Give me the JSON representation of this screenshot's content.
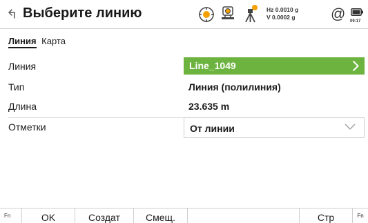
{
  "header": {
    "title": "Выберите линию",
    "hz_line": "Hz 0.0010 g",
    "v_line": "V  0.0002 g",
    "at_symbol": "@",
    "time": "09:17",
    "icons": [
      "back-icon",
      "target-icon",
      "instrument-icon",
      "tripod-icon",
      "battery-icon"
    ]
  },
  "tabs": {
    "active": "Линия",
    "other": "Карта"
  },
  "form": {
    "line_label": "Линия",
    "line_value": "Line_1049",
    "type_label": "Тип",
    "type_value": "Линия (полилиния)",
    "length_label": "Длина",
    "length_value": "23.635 m",
    "marks_label": "Отметки",
    "marks_value": "От линии"
  },
  "softkeys": {
    "fn_left": "Fn",
    "ok": "OK",
    "create": "Создат",
    "offset": "Смещ.",
    "page": "Стр",
    "fn_right": "Fn"
  },
  "colors": {
    "accent_green": "#6cb33f",
    "tripod_dot": "#f4a100"
  }
}
